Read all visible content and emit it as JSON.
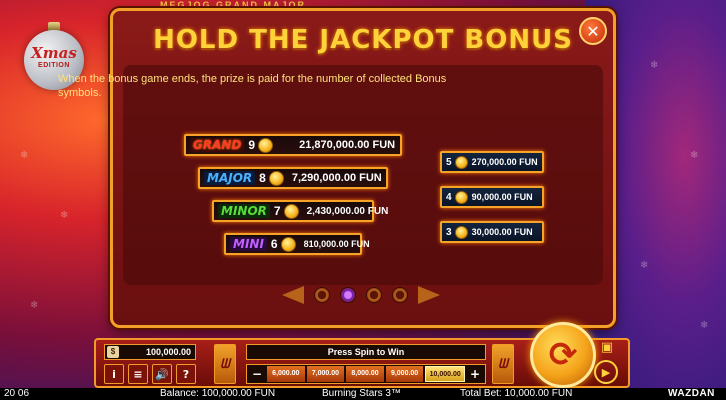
{
  "title": "HOLD THE JACKPOT BONUS",
  "close_icon": "close-x",
  "ornament": {
    "line1": "Xmas",
    "line2": "EDITION"
  },
  "top_reels_text": "MEGJOG GRAND MAJOR",
  "description": "When the bonus game ends, the prize is paid for the number of collected Bonus symbols.",
  "jackpots": [
    {
      "name": "GRAND",
      "count": "9",
      "value": "21,870,000.00 FUN"
    },
    {
      "name": "MAJOR",
      "count": "8",
      "value": "7,290,000.00 FUN"
    },
    {
      "name": "MINOR",
      "count": "7",
      "value": "2,430,000.00 FUN"
    },
    {
      "name": "MINI",
      "count": "6",
      "value": "810,000.00 FUN"
    }
  ],
  "small_prizes": [
    {
      "count": "5",
      "value": "270,000.00 FUN"
    },
    {
      "count": "4",
      "value": "90,000.00 FUN"
    },
    {
      "count": "3",
      "value": "30,000.00 FUN"
    }
  ],
  "pager": {
    "pages": 4,
    "active": 2
  },
  "controls": {
    "balance": "100,000.00",
    "message": "Press Spin to Win",
    "bet_minus": "−",
    "bet_plus": "+",
    "bets": [
      "6,000.00",
      "7,000.00",
      "8,000.00",
      "9,000.00",
      "10,000.00"
    ],
    "selected_bet": "10,000.00",
    "info": "i",
    "menu": "≡",
    "sound": "🔊",
    "help": "?"
  },
  "footer": {
    "time": "20 06",
    "balance": "Balance: 100,000.00 FUN",
    "game": "Burning Stars 3™",
    "total_bet": "Total Bet: 10,000.00 FUN",
    "brand": "WAZDAN"
  },
  "colors": {
    "panel_border": "#f3a02a",
    "title": "#ffd23a",
    "grand": "#ff3a2a",
    "major": "#4ab2ff",
    "minor": "#5adc3a",
    "mini": "#c060ff"
  }
}
